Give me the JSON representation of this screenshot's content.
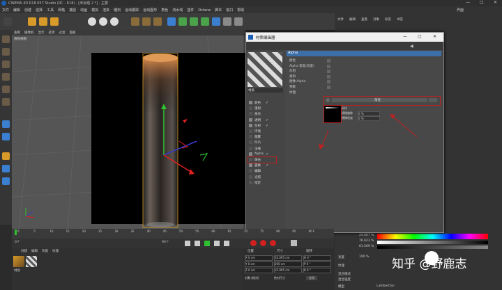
{
  "window": {
    "title": "CINEMA 4D R18.057 Studio (RC - R18) - [未标题 2 *] - 主要",
    "minimize": "—",
    "maximize": "□",
    "close": "✕"
  },
  "menu": [
    "文件",
    "编辑",
    "创建",
    "选择",
    "工具",
    "网格",
    "捕捉",
    "动画",
    "模拟",
    "渲染",
    "雕刻",
    "运动跟踪",
    "运动图形",
    "角色",
    "流水线",
    "插件",
    "Octane",
    "脚本",
    "窗口",
    "帮助"
  ],
  "layout_label": "界面",
  "viewport": {
    "menu": [
      "查看",
      "摄像机",
      "显示",
      "选项",
      "过滤",
      "面板"
    ],
    "name": "透视视图"
  },
  "dialog": {
    "title": "材质编辑器",
    "min": "—",
    "max": "□",
    "close": "✕",
    "material_name": "材质",
    "header": "Alpha",
    "channels": [
      {
        "label": "颜色",
        "checked": true
      },
      {
        "label": "漫射",
        "checked": false
      },
      {
        "label": "发光",
        "checked": false
      },
      {
        "label": "透明",
        "checked": true
      },
      {
        "label": "反射",
        "checked": true
      },
      {
        "label": "环境",
        "checked": false
      },
      {
        "label": "烟雾",
        "checked": false
      },
      {
        "label": "凹凸",
        "checked": false
      },
      {
        "label": "法线",
        "checked": false
      },
      {
        "label": "Alpha",
        "checked": true
      },
      {
        "label": "辉光",
        "checked": false
      },
      {
        "label": "置换",
        "checked": true
      },
      {
        "label": "编辑",
        "checked": false
      },
      {
        "label": "光照",
        "checked": false
      },
      {
        "label": "指定",
        "checked": false
      }
    ],
    "props": [
      "颜色",
      "Alpha 容差(亮度)",
      "反相",
      "柔和",
      "图像 Alpha",
      "预乘",
      "纹理"
    ],
    "texture_name": "渐变",
    "sub_props": [
      {
        "label": "采样",
        "value": ""
      },
      {
        "label": "模糊偏移",
        "value": "0 %"
      },
      {
        "label": "模糊程度",
        "value": "0 %"
      }
    ]
  },
  "timeline": {
    "ticks": [
      "0",
      "5",
      "10",
      "15",
      "20",
      "25",
      "30",
      "35",
      "40",
      "45",
      "50",
      "55",
      "60",
      "65",
      "70",
      "75",
      "80",
      "85",
      "90 F"
    ],
    "start": "0 F",
    "end": "90 F"
  },
  "materials_menu": [
    "创建",
    "编辑",
    "功能",
    "纹理"
  ],
  "material_slot": "材质",
  "coords": {
    "headers": [
      "位置",
      "尺寸",
      "旋转"
    ],
    "rows": [
      [
        "X 0 cm",
        "32.095 cm",
        "H 0 °"
      ],
      [
        "Y 0 cm",
        "200 cm",
        "P 0 °"
      ],
      [
        "Z 0 cm",
        "32.095 cm",
        "B 0 °"
      ]
    ],
    "mode": "对象 (相对)",
    "size_mode": "绝对尺寸",
    "apply": "应用"
  },
  "right_panel": {
    "menu": [
      "文件",
      "编辑",
      "查看",
      "对象",
      "标签",
      "书签"
    ],
    "tab": "模式",
    "values": [
      "24.667 %",
      "76.623 %",
      "61.569 %"
    ],
    "brightness": "100 %",
    "labels": [
      "亮度",
      "纹理",
      "混合模式",
      "混合强度",
      "模型"
    ],
    "model": "Lambertian"
  },
  "watermark": "知乎 @野鹿志"
}
